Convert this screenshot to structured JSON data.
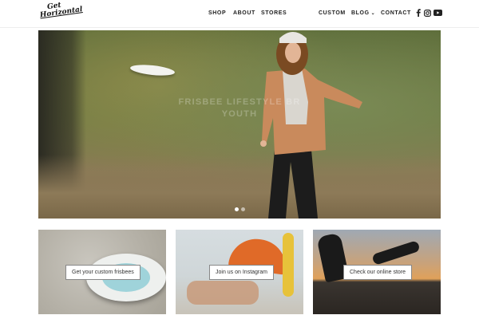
{
  "logo": {
    "line1": "Get",
    "line2": "Horizontal"
  },
  "nav": {
    "shop": "SHOP",
    "about": "ABOUT",
    "stores": "STORES",
    "custom": "CUSTOM",
    "blog": "BLOG",
    "contact": "CONTACT"
  },
  "social_icons": [
    "facebook-icon",
    "instagram-icon",
    "youtube-icon"
  ],
  "hero": {
    "caption_line1": "FRISBEE LIFESTYLE BR",
    "caption_line2": "YOUTH",
    "slides_total": 2,
    "active_slide": 1
  },
  "tiles": [
    {
      "button": "Get your custom frisbees"
    },
    {
      "button": "Join us on Instagram"
    },
    {
      "button": "Check our online store"
    }
  ],
  "colors": {
    "header_bg": "#ffffff",
    "text": "#222222",
    "accent_orange": "#e06a28"
  }
}
